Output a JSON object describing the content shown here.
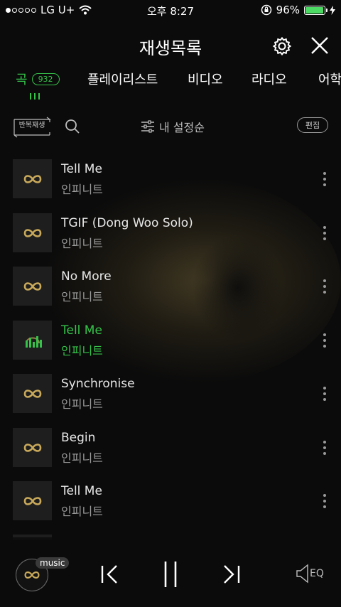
{
  "status_bar": {
    "carrier": "LG U+",
    "time": "오후 8:27",
    "battery_percent": "96%",
    "signal_bars_filled": 1,
    "signal_bars_total": 5,
    "battery_level": 0.96
  },
  "header": {
    "title": "재생목록",
    "settings_icon": "gear-icon",
    "close_icon": "close-icon"
  },
  "tabs": [
    {
      "label": "곡",
      "badge": "932",
      "active": true
    },
    {
      "label": "플레이리스트",
      "active": false
    },
    {
      "label": "비디오",
      "active": false
    },
    {
      "label": "라디오",
      "active": false
    },
    {
      "label": "어학",
      "active": false
    }
  ],
  "controls": {
    "repeat_label": "반복재생",
    "sort_label": "내 설정순",
    "edit_label": "편집"
  },
  "songs": [
    {
      "title": "Tell Me",
      "artist": "인피니트",
      "playing": false
    },
    {
      "title": "TGIF (Dong Woo Solo)",
      "artist": "인피니트",
      "playing": false
    },
    {
      "title": "No More",
      "artist": "인피니트",
      "playing": false
    },
    {
      "title": "Tell Me",
      "artist": "인피니트",
      "playing": true
    },
    {
      "title": "Synchronise",
      "artist": "인피니트",
      "playing": false
    },
    {
      "title": "Begin",
      "artist": "인피니트",
      "playing": false
    },
    {
      "title": "Tell Me",
      "artist": "인피니트",
      "playing": false
    }
  ],
  "player": {
    "music_tag": "music",
    "eq_label": "EQ"
  },
  "colors": {
    "accent": "#35c24a",
    "infinity_logo": "#c9a95a",
    "background": "#0b0b0b"
  }
}
